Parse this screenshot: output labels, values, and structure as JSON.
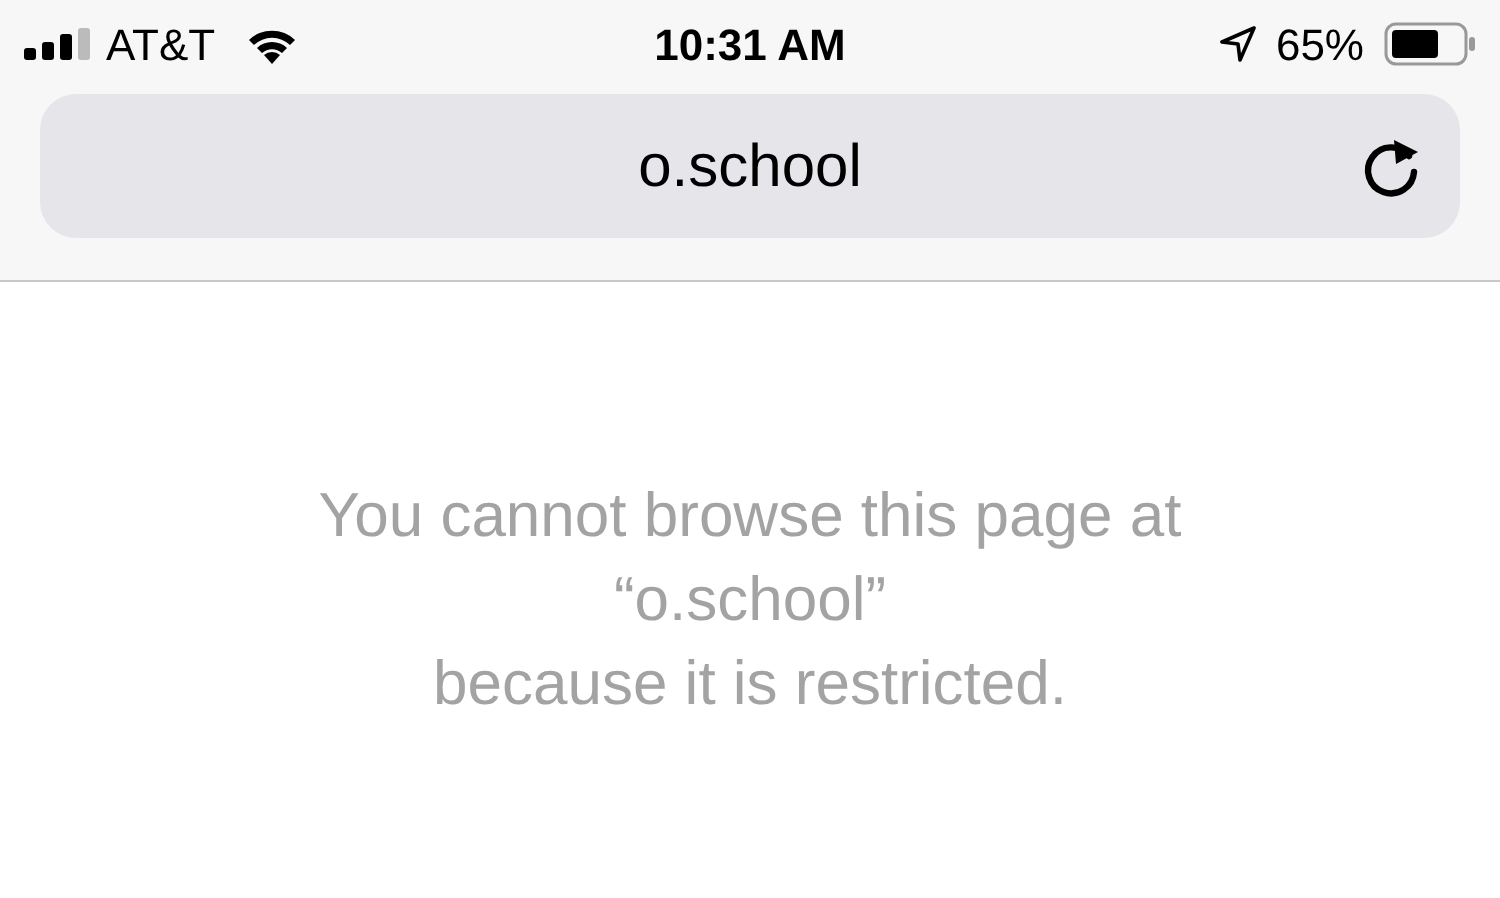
{
  "status_bar": {
    "carrier": "AT&T",
    "time": "10:31 AM",
    "battery": "65%"
  },
  "address_bar": {
    "url": "o.school"
  },
  "message": [
    "You cannot browse this page at",
    "“o.school”",
    "because it is restricted."
  ]
}
